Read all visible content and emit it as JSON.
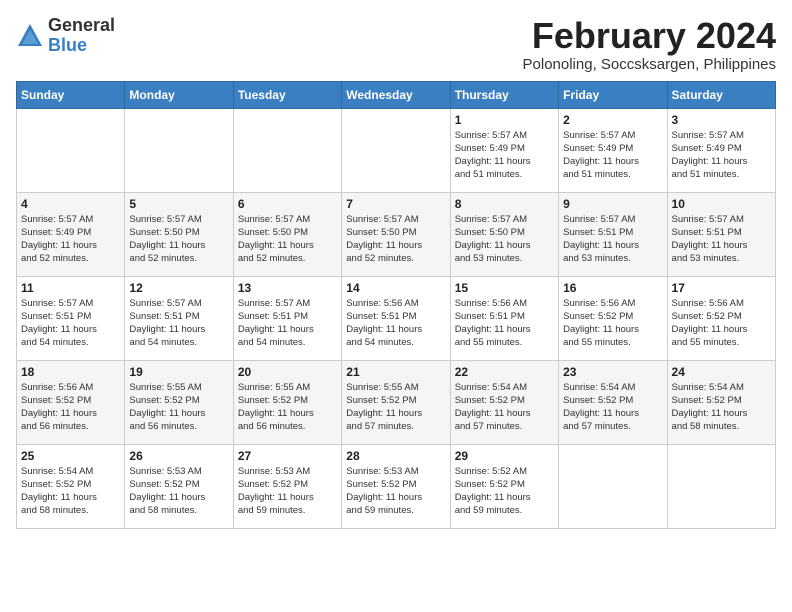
{
  "logo": {
    "general": "General",
    "blue": "Blue"
  },
  "header": {
    "month_year": "February 2024",
    "location": "Polonoling, Soccsksargen, Philippines"
  },
  "columns": [
    "Sunday",
    "Monday",
    "Tuesday",
    "Wednesday",
    "Thursday",
    "Friday",
    "Saturday"
  ],
  "weeks": [
    [
      {
        "day": "",
        "info": ""
      },
      {
        "day": "",
        "info": ""
      },
      {
        "day": "",
        "info": ""
      },
      {
        "day": "",
        "info": ""
      },
      {
        "day": "1",
        "info": "Sunrise: 5:57 AM\nSunset: 5:49 PM\nDaylight: 11 hours\nand 51 minutes."
      },
      {
        "day": "2",
        "info": "Sunrise: 5:57 AM\nSunset: 5:49 PM\nDaylight: 11 hours\nand 51 minutes."
      },
      {
        "day": "3",
        "info": "Sunrise: 5:57 AM\nSunset: 5:49 PM\nDaylight: 11 hours\nand 51 minutes."
      }
    ],
    [
      {
        "day": "4",
        "info": "Sunrise: 5:57 AM\nSunset: 5:49 PM\nDaylight: 11 hours\nand 52 minutes."
      },
      {
        "day": "5",
        "info": "Sunrise: 5:57 AM\nSunset: 5:50 PM\nDaylight: 11 hours\nand 52 minutes."
      },
      {
        "day": "6",
        "info": "Sunrise: 5:57 AM\nSunset: 5:50 PM\nDaylight: 11 hours\nand 52 minutes."
      },
      {
        "day": "7",
        "info": "Sunrise: 5:57 AM\nSunset: 5:50 PM\nDaylight: 11 hours\nand 52 minutes."
      },
      {
        "day": "8",
        "info": "Sunrise: 5:57 AM\nSunset: 5:50 PM\nDaylight: 11 hours\nand 53 minutes."
      },
      {
        "day": "9",
        "info": "Sunrise: 5:57 AM\nSunset: 5:51 PM\nDaylight: 11 hours\nand 53 minutes."
      },
      {
        "day": "10",
        "info": "Sunrise: 5:57 AM\nSunset: 5:51 PM\nDaylight: 11 hours\nand 53 minutes."
      }
    ],
    [
      {
        "day": "11",
        "info": "Sunrise: 5:57 AM\nSunset: 5:51 PM\nDaylight: 11 hours\nand 54 minutes."
      },
      {
        "day": "12",
        "info": "Sunrise: 5:57 AM\nSunset: 5:51 PM\nDaylight: 11 hours\nand 54 minutes."
      },
      {
        "day": "13",
        "info": "Sunrise: 5:57 AM\nSunset: 5:51 PM\nDaylight: 11 hours\nand 54 minutes."
      },
      {
        "day": "14",
        "info": "Sunrise: 5:56 AM\nSunset: 5:51 PM\nDaylight: 11 hours\nand 54 minutes."
      },
      {
        "day": "15",
        "info": "Sunrise: 5:56 AM\nSunset: 5:51 PM\nDaylight: 11 hours\nand 55 minutes."
      },
      {
        "day": "16",
        "info": "Sunrise: 5:56 AM\nSunset: 5:52 PM\nDaylight: 11 hours\nand 55 minutes."
      },
      {
        "day": "17",
        "info": "Sunrise: 5:56 AM\nSunset: 5:52 PM\nDaylight: 11 hours\nand 55 minutes."
      }
    ],
    [
      {
        "day": "18",
        "info": "Sunrise: 5:56 AM\nSunset: 5:52 PM\nDaylight: 11 hours\nand 56 minutes."
      },
      {
        "day": "19",
        "info": "Sunrise: 5:55 AM\nSunset: 5:52 PM\nDaylight: 11 hours\nand 56 minutes."
      },
      {
        "day": "20",
        "info": "Sunrise: 5:55 AM\nSunset: 5:52 PM\nDaylight: 11 hours\nand 56 minutes."
      },
      {
        "day": "21",
        "info": "Sunrise: 5:55 AM\nSunset: 5:52 PM\nDaylight: 11 hours\nand 57 minutes."
      },
      {
        "day": "22",
        "info": "Sunrise: 5:54 AM\nSunset: 5:52 PM\nDaylight: 11 hours\nand 57 minutes."
      },
      {
        "day": "23",
        "info": "Sunrise: 5:54 AM\nSunset: 5:52 PM\nDaylight: 11 hours\nand 57 minutes."
      },
      {
        "day": "24",
        "info": "Sunrise: 5:54 AM\nSunset: 5:52 PM\nDaylight: 11 hours\nand 58 minutes."
      }
    ],
    [
      {
        "day": "25",
        "info": "Sunrise: 5:54 AM\nSunset: 5:52 PM\nDaylight: 11 hours\nand 58 minutes."
      },
      {
        "day": "26",
        "info": "Sunrise: 5:53 AM\nSunset: 5:52 PM\nDaylight: 11 hours\nand 58 minutes."
      },
      {
        "day": "27",
        "info": "Sunrise: 5:53 AM\nSunset: 5:52 PM\nDaylight: 11 hours\nand 59 minutes."
      },
      {
        "day": "28",
        "info": "Sunrise: 5:53 AM\nSunset: 5:52 PM\nDaylight: 11 hours\nand 59 minutes."
      },
      {
        "day": "29",
        "info": "Sunrise: 5:52 AM\nSunset: 5:52 PM\nDaylight: 11 hours\nand 59 minutes."
      },
      {
        "day": "",
        "info": ""
      },
      {
        "day": "",
        "info": ""
      }
    ]
  ]
}
